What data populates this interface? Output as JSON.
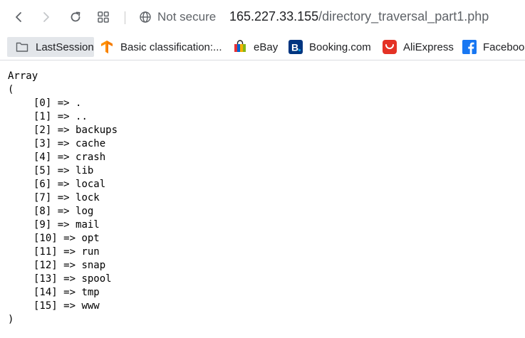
{
  "browser": {
    "security_label": "Not secure",
    "url_host": "165.227.33.155",
    "url_path": "/directory_traversal_part1.php",
    "accent_color": "#5f6368"
  },
  "bookmarks": [
    {
      "label": "LastSession",
      "icon": "folder-icon"
    },
    {
      "label": "Basic classification:...",
      "icon": "tensorflow-icon",
      "color": "#ff8f00"
    },
    {
      "label": "eBay",
      "icon": "ebay-icon"
    },
    {
      "label": "Booking.com",
      "icon": "booking-icon",
      "color": "#003580"
    },
    {
      "label": "AliExpress",
      "icon": "aliexpress-icon",
      "color": "#e43225"
    },
    {
      "label": "Facebook",
      "icon": "facebook-icon",
      "color": "#1877f2"
    }
  ],
  "output": {
    "open_word": "Array",
    "open_paren": "(",
    "close_paren": ")",
    "entries": [
      {
        "key": "[0]",
        "value": "."
      },
      {
        "key": "[1]",
        "value": ".."
      },
      {
        "key": "[2]",
        "value": "backups"
      },
      {
        "key": "[3]",
        "value": "cache"
      },
      {
        "key": "[4]",
        "value": "crash"
      },
      {
        "key": "[5]",
        "value": "lib"
      },
      {
        "key": "[6]",
        "value": "local"
      },
      {
        "key": "[7]",
        "value": "lock"
      },
      {
        "key": "[8]",
        "value": "log"
      },
      {
        "key": "[9]",
        "value": "mail"
      },
      {
        "key": "[10]",
        "value": "opt"
      },
      {
        "key": "[11]",
        "value": "run"
      },
      {
        "key": "[12]",
        "value": "snap"
      },
      {
        "key": "[13]",
        "value": "spool"
      },
      {
        "key": "[14]",
        "value": "tmp"
      },
      {
        "key": "[15]",
        "value": "www"
      }
    ]
  }
}
